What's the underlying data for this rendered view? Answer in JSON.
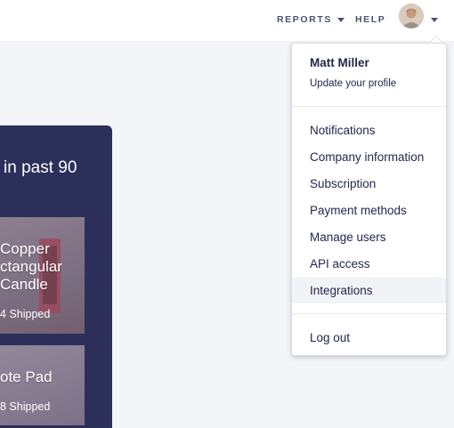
{
  "header": {
    "reports_label": "REPORTS",
    "help_label": "HELP"
  },
  "dashboard": {
    "panel_heading": "in past 90",
    "cards": [
      {
        "title": "Copper\nctangular\nCandle",
        "shipped": "4 Shipped"
      },
      {
        "title": "ote Pad",
        "shipped": "8 Shipped"
      }
    ]
  },
  "dropdown": {
    "user_name": "Matt Miller",
    "update_profile": "Update your profile",
    "items": [
      {
        "label": "Notifications"
      },
      {
        "label": "Company information"
      },
      {
        "label": "Subscription"
      },
      {
        "label": "Payment methods"
      },
      {
        "label": "Manage users"
      },
      {
        "label": "API access"
      },
      {
        "label": "Integrations"
      }
    ],
    "logout_label": "Log out"
  },
  "colors": {
    "nav_text": "#4b5370",
    "panel_bg": "#2b2f5a",
    "menu_text": "#23284a",
    "hover_bg": "#f2f3f6"
  }
}
